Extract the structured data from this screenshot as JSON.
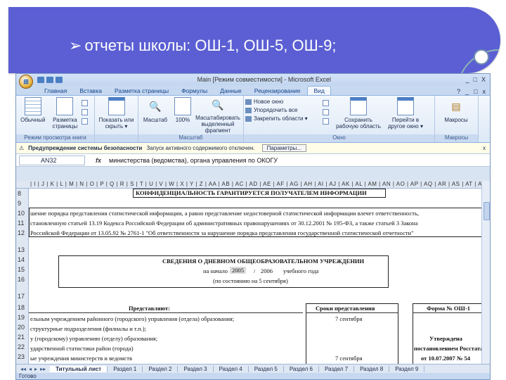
{
  "slide": {
    "bullet": "➢",
    "title": "отчеты школы: ОШ-1, ОШ-5, ОШ-9;"
  },
  "excel": {
    "title": "Main [Режим совместимости] - Microsoft Excel",
    "office_button": "⊞",
    "window_buttons": [
      "_",
      "□",
      "X"
    ],
    "mdi_buttons": [
      "?",
      "_",
      "□",
      "x"
    ],
    "tabs": [
      "Главная",
      "Вставка",
      "Разметка страницы",
      "Формулы",
      "Данные",
      "Рецензирование",
      "Вид"
    ],
    "active_tab": "Вид",
    "ribbon": {
      "view_modes": {
        "normal": "Обычный",
        "page_layout": "Разметка страницы",
        "group_label": "Режим просмотра книги"
      },
      "show": {
        "show_hide": "Показать или скрыть ▾"
      },
      "zoom": {
        "zoom": "Масштаб",
        "hundred": "100%",
        "to_selection": "Масштабировать выделенный фрагмент",
        "group_label": "Масштаб"
      },
      "window": {
        "new_window": "Новое окно",
        "arrange_all": "Упорядочить все",
        "freeze_panes": "Закрепить области ▾",
        "save_workspace": "Сохранить рабочую область",
        "switch_windows": "Перейти в другое окно ▾",
        "group_label": "Окно"
      },
      "macros": {
        "macros": "Макросы",
        "group_label": "Макросы"
      }
    },
    "security": {
      "warning_label": "Предупреждение системы безопасности",
      "message": "Запуск активного содержимого отключен.",
      "options_button": "Параметры...",
      "close": "x"
    },
    "formula_bar": {
      "name_box": "AN32",
      "fx": "fx",
      "formula": "министерства (ведомства), органа управления по ОКОГУ"
    },
    "column_header": "| I | J | K | L | M | N | O | P | Q | R | S | T | U | V | W | X | Y | Z | AA | AB | AC | AD | AE | AF | AG | AH | AI | AJ | AK | AL | AM | AN | AO | AP | AQ | AR | AS | AT | AU | AV | AW | AX | AY | AZ | BA | BB | BC | BD | BE | BF | BG | BH | BI | BJ | BK | BL | BM | BN | BO | BP | BQ | BR | BS | BT | BU | BV | BW | BX | BY | BZ | CA | CB | CC",
    "row_numbers": [
      "8",
      "9",
      "10",
      "11",
      "12",
      "13",
      "14",
      "15",
      "16",
      "17",
      "18",
      "19",
      "20",
      "21",
      "22",
      "23"
    ],
    "cells": {
      "confidential": "КОНФИДЕНЦИАЛЬНОСТЬ ГАРАНТИРУЕТСЯ ПОЛУЧАТЕЛЕМ ИНФОРМАЦИИ",
      "line10": "шение порядка представления статистической информации, а равно представление недостоверной статистической информации влечет ответственность,",
      "line11": "становленную статьей 13.19 Кодекса Российской Федерации об административных правонарушениях от 30.12.2001 № 195-ФЗ, а также статьей 3 Закона",
      "line12": "Российской Федерации от 13.05.92 № 2761-1 \"Об ответственности за нарушение порядка представления государственной статистической отчетности\"",
      "form_title": "СВЕДЕНИЯ О ДНЕВНОМ ОБЩЕОБРАЗОВАТЕЛЬНОМ УЧРЕЖДЕНИИ",
      "year_prefix": "на начало",
      "year_from": "2005",
      "year_slash": "/",
      "year_to": "2006",
      "year_suffix": "учебного года",
      "as_of": "(по состоянию на 5 сентября)",
      "submit_header": "Представляют:",
      "deadline_header": "Сроки представления",
      "form_number": "Форма № ОШ-1",
      "row19": "ельным учреждением районного (городского) управления (отдела) образования;",
      "row19_date": "7 сентября",
      "row20": "структурные подразделения (филиалы и т.п.);",
      "row21": "у (городскому) управлению (отделу) образования;",
      "row22": "ударственной статистики район (города)",
      "row23": "ые учреждения министерств и ведомств",
      "row23_date": "7 сентября",
      "approved": "Утверждена",
      "approved_by": "постановлением Росстата",
      "approved_date": "от 10.07.2007 № 54"
    },
    "sheet_nav": [
      "◂◂",
      "◂",
      "▸",
      "▸▸"
    ],
    "sheets": [
      "Титульный лист",
      "Раздел 1",
      "Раздел 2",
      "Раздел 3",
      "Раздел 4",
      "Раздел 5",
      "Раздел 6",
      "Раздел 7",
      "Раздел 8",
      "Раздел 9"
    ],
    "active_sheet": "Титульный лист",
    "status": "Готово"
  }
}
